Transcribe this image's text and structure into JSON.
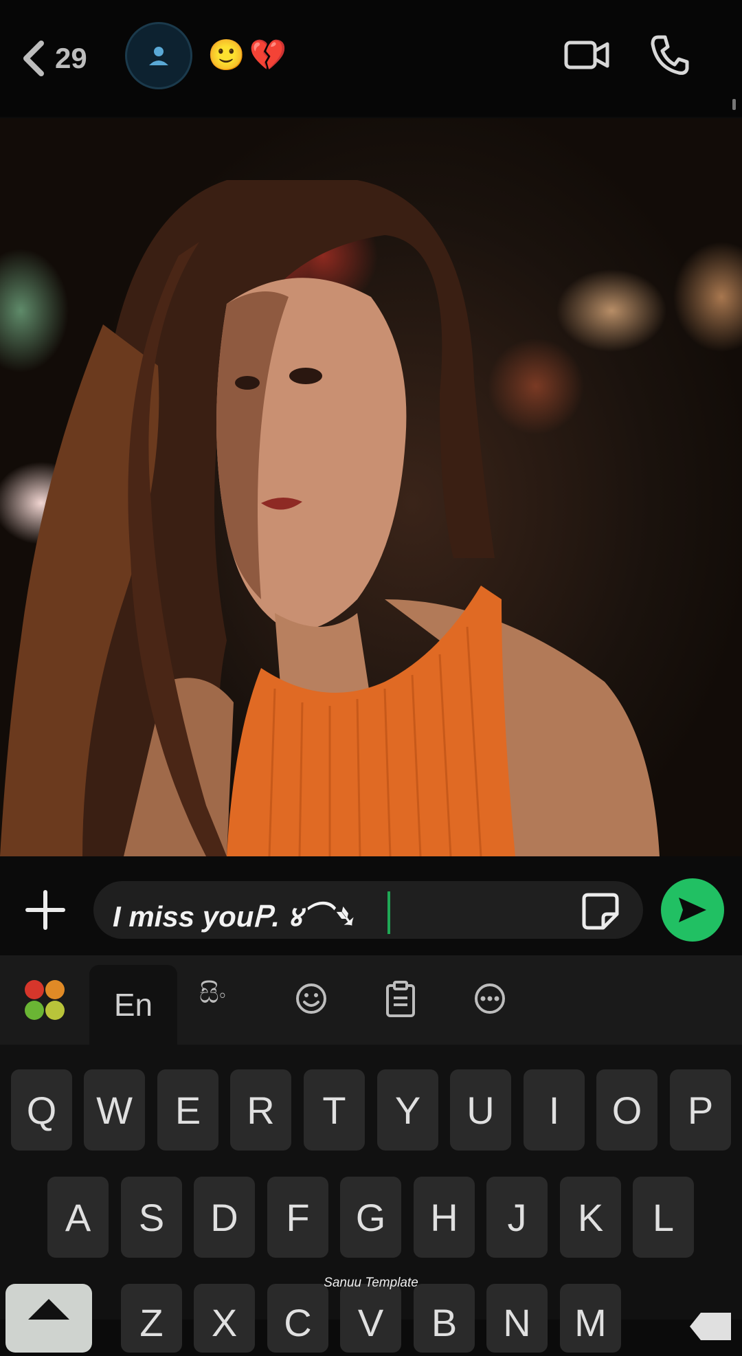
{
  "header": {
    "back_count": "29",
    "status_emojis": "🙂💔"
  },
  "composer": {
    "message_text": "I miss youᏢ. ४⌒➴"
  },
  "keyboard_toolbar": {
    "lang_en": "En",
    "lang_si": "සිං"
  },
  "keyboard": {
    "row1": [
      "Q",
      "W",
      "E",
      "R",
      "T",
      "Y",
      "U",
      "I",
      "O",
      "P"
    ],
    "row2": [
      "A",
      "S",
      "D",
      "F",
      "G",
      "H",
      "J",
      "K",
      "L"
    ],
    "row3": [
      "Z",
      "X",
      "C",
      "V",
      "B",
      "N",
      "M"
    ]
  },
  "watermark": "Sanuu Template",
  "colors": {
    "accent_green": "#21c063",
    "cursor_green": "#1fa855",
    "background": "#0b0b0b"
  }
}
